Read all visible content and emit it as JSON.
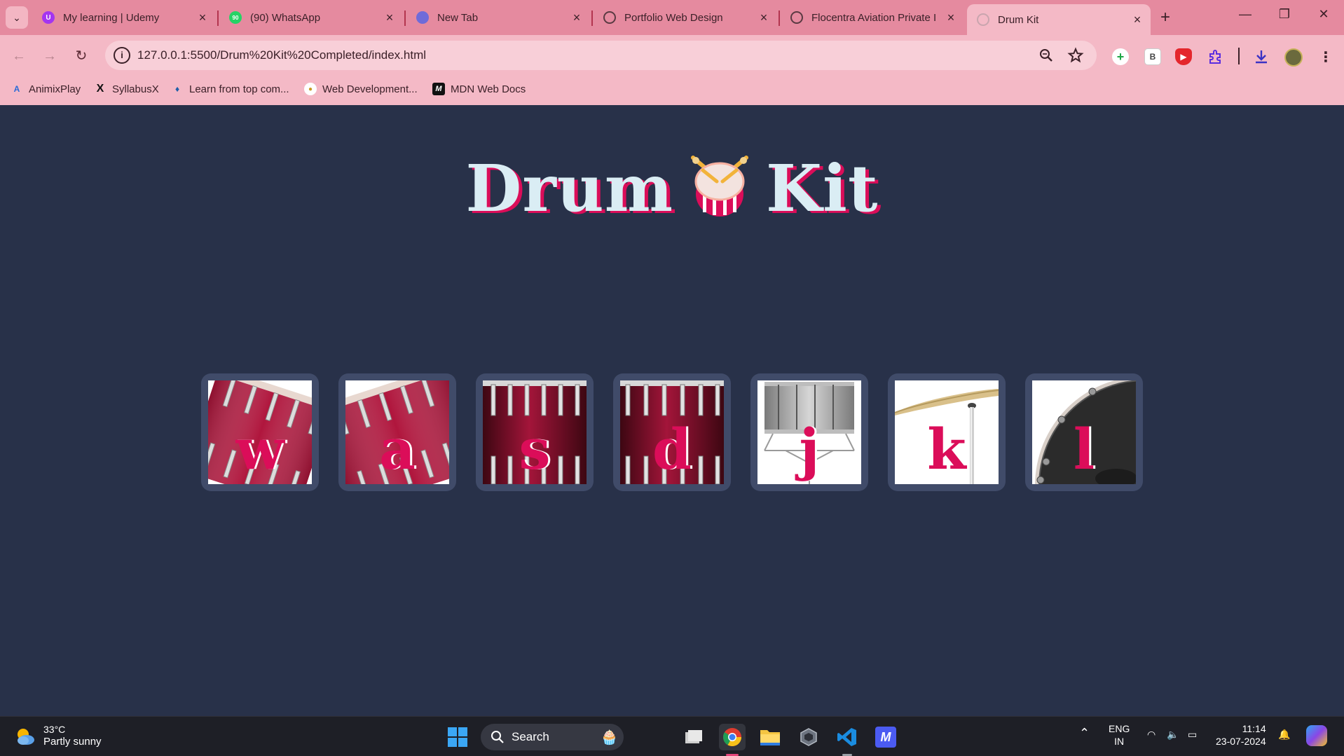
{
  "browser": {
    "tabs": [
      {
        "title": "My learning | Udemy",
        "icon": "udemy-icon",
        "color": "#a435f0",
        "glyph": "U"
      },
      {
        "title": "(90) WhatsApp",
        "icon": "whatsapp-icon",
        "color": "#25d366",
        "glyph": "90"
      },
      {
        "title": "New Tab",
        "icon": "chrome-icon",
        "color": "#6f6bd9",
        "glyph": ""
      },
      {
        "title": "Portfolio Web Design",
        "icon": "globe-icon",
        "color": "#5a3a42",
        "glyph": ""
      },
      {
        "title": "Flocentra Aviation Private I",
        "icon": "globe-icon",
        "color": "#5a3a42",
        "glyph": ""
      },
      {
        "title": "Drum Kit",
        "icon": "globe-icon",
        "color": "#c9a5ae",
        "glyph": ""
      }
    ],
    "url": "127.0.0.1:5500/Drum%20Kit%20Completed/index.html",
    "bookmarks": [
      {
        "label": "AnimixPlay",
        "icon": "animix-icon"
      },
      {
        "label": "SyllabusX",
        "icon": "x-icon"
      },
      {
        "label": "Learn from top com...",
        "icon": "learn-icon"
      },
      {
        "label": "Web Development...",
        "icon": "webdev-icon"
      },
      {
        "label": "MDN Web Docs",
        "icon": "mdn-icon"
      }
    ]
  },
  "page": {
    "title_left": "Drum",
    "title_right": "Kit",
    "colors": {
      "background": "#283149",
      "title": "#daedf4",
      "accent": "#db0d59",
      "pad": "#404b69"
    },
    "pads": [
      {
        "key": "w",
        "image": "tom-1"
      },
      {
        "key": "a",
        "image": "tom-2"
      },
      {
        "key": "s",
        "image": "tom-3"
      },
      {
        "key": "d",
        "image": "tom-4"
      },
      {
        "key": "j",
        "image": "snare"
      },
      {
        "key": "k",
        "image": "crash"
      },
      {
        "key": "l",
        "image": "kick"
      }
    ]
  },
  "taskbar": {
    "weather_temp": "33°C",
    "weather_cond": "Partly sunny",
    "search": "Search",
    "lang_top": "ENG",
    "lang_bottom": "IN",
    "time": "11:14",
    "date": "23-07-2024"
  }
}
